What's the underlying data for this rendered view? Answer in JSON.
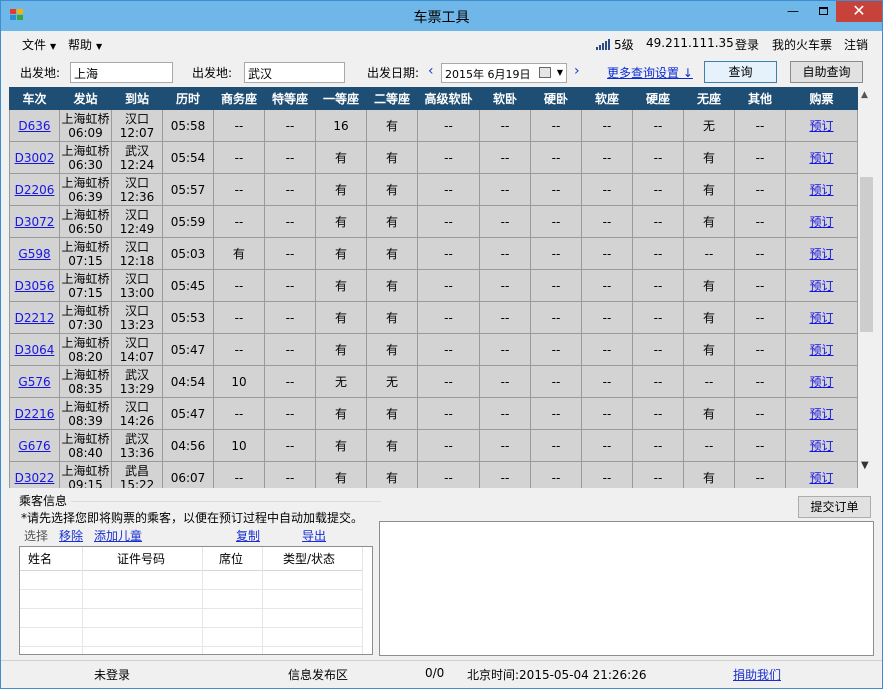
{
  "window": {
    "title": "车票工具",
    "min_label": "—",
    "close_label": "✕"
  },
  "menu": {
    "file": "文件",
    "help": "帮助"
  },
  "topbar": {
    "signal_level": "5级",
    "ip": "49.211.111.35",
    "login": "登录",
    "my_tickets": "我的火车票",
    "logout": "注销"
  },
  "search": {
    "from_label": "出发地:",
    "from_value": "上海",
    "to_label": "出发地:",
    "to_value": "武汉",
    "date_label": "出发日期:",
    "date_value": "2015年  6月19日",
    "prev": "‹",
    "next": "›",
    "more_settings": "更多查询设置 ↓",
    "query_button": "查询",
    "self_query_button": "自助查询"
  },
  "table": {
    "headers": [
      "车次",
      "发站",
      "到站",
      "历时",
      "商务座",
      "特等座",
      "一等座",
      "二等座",
      "高级软卧",
      "软卧",
      "硬卧",
      "软座",
      "硬座",
      "无座",
      "其他",
      "购票"
    ],
    "rows": [
      [
        "D636",
        "上海虹桥",
        "06:09",
        "汉口",
        "12:07",
        "05:58",
        "--",
        "--",
        "16",
        "有",
        "--",
        "--",
        "--",
        "--",
        "--",
        "无",
        "--",
        "预订"
      ],
      [
        "D3002",
        "上海虹桥",
        "06:30",
        "武汉",
        "12:24",
        "05:54",
        "--",
        "--",
        "有",
        "有",
        "--",
        "--",
        "--",
        "--",
        "--",
        "有",
        "--",
        "预订"
      ],
      [
        "D2206",
        "上海虹桥",
        "06:39",
        "汉口",
        "12:36",
        "05:57",
        "--",
        "--",
        "有",
        "有",
        "--",
        "--",
        "--",
        "--",
        "--",
        "有",
        "--",
        "预订"
      ],
      [
        "D3072",
        "上海虹桥",
        "06:50",
        "汉口",
        "12:49",
        "05:59",
        "--",
        "--",
        "有",
        "有",
        "--",
        "--",
        "--",
        "--",
        "--",
        "有",
        "--",
        "预订"
      ],
      [
        "G598",
        "上海虹桥",
        "07:15",
        "汉口",
        "12:18",
        "05:03",
        "有",
        "--",
        "有",
        "有",
        "--",
        "--",
        "--",
        "--",
        "--",
        "--",
        "--",
        "预订"
      ],
      [
        "D3056",
        "上海虹桥",
        "07:15",
        "汉口",
        "13:00",
        "05:45",
        "--",
        "--",
        "有",
        "有",
        "--",
        "--",
        "--",
        "--",
        "--",
        "有",
        "--",
        "预订"
      ],
      [
        "D2212",
        "上海虹桥",
        "07:30",
        "汉口",
        "13:23",
        "05:53",
        "--",
        "--",
        "有",
        "有",
        "--",
        "--",
        "--",
        "--",
        "--",
        "有",
        "--",
        "预订"
      ],
      [
        "D3064",
        "上海虹桥",
        "08:20",
        "汉口",
        "14:07",
        "05:47",
        "--",
        "--",
        "有",
        "有",
        "--",
        "--",
        "--",
        "--",
        "--",
        "有",
        "--",
        "预订"
      ],
      [
        "G576",
        "上海虹桥",
        "08:35",
        "武汉",
        "13:29",
        "04:54",
        "10",
        "--",
        "无",
        "无",
        "--",
        "--",
        "--",
        "--",
        "--",
        "--",
        "--",
        "预订"
      ],
      [
        "D2216",
        "上海虹桥",
        "08:39",
        "汉口",
        "14:26",
        "05:47",
        "--",
        "--",
        "有",
        "有",
        "--",
        "--",
        "--",
        "--",
        "--",
        "有",
        "--",
        "预订"
      ],
      [
        "G676",
        "上海虹桥",
        "08:40",
        "武汉",
        "13:36",
        "04:56",
        "10",
        "--",
        "有",
        "有",
        "--",
        "--",
        "--",
        "--",
        "--",
        "--",
        "--",
        "预订"
      ],
      [
        "D3022",
        "上海虹桥",
        "09:15",
        "武昌",
        "15:22",
        "06:07",
        "--",
        "--",
        "有",
        "有",
        "--",
        "--",
        "--",
        "--",
        "--",
        "有",
        "--",
        "预订"
      ]
    ]
  },
  "passengers": {
    "title": "乘客信息",
    "hint": "*请先选择您即将购票的乘客，以便在预订过程中自动加载提交。",
    "select": "选择",
    "remove": "移除",
    "add_child": "添加儿童",
    "copy": "复制",
    "export": "导出",
    "columns": [
      "姓名",
      "证件号码",
      "席位",
      "类型/状态"
    ]
  },
  "order": {
    "submit": "提交订单"
  },
  "status": {
    "login_state": "未登录",
    "info_area": "信息发布区",
    "count": "0/0",
    "time": "北京时间:2015-05-04 21:26:26",
    "donate": "捐助我们"
  }
}
